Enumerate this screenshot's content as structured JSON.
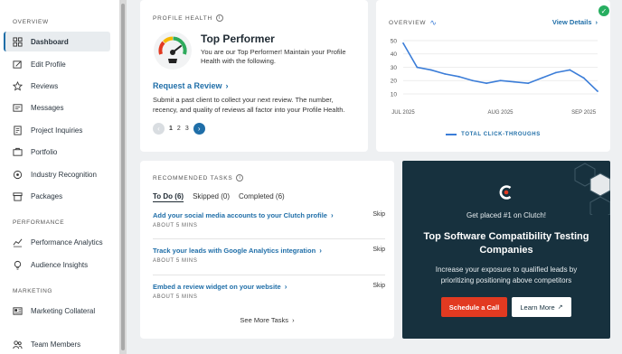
{
  "sidebar": {
    "sections": [
      "OVERVIEW",
      "PERFORMANCE",
      "MARKETING"
    ],
    "items": [
      {
        "label": "Dashboard",
        "icon": "grid-icon"
      },
      {
        "label": "Edit Profile",
        "icon": "edit-profile-icon"
      },
      {
        "label": "Reviews",
        "icon": "star-icon"
      },
      {
        "label": "Messages",
        "icon": "messages-icon"
      },
      {
        "label": "Project Inquiries",
        "icon": "inquiries-icon"
      },
      {
        "label": "Portfolio",
        "icon": "portfolio-icon"
      },
      {
        "label": "Industry Recognition",
        "icon": "recognition-icon"
      },
      {
        "label": "Packages",
        "icon": "packages-icon"
      },
      {
        "label": "Performance Analytics",
        "icon": "analytics-icon"
      },
      {
        "label": "Audience Insights",
        "icon": "bulb-icon"
      },
      {
        "label": "Marketing Collateral",
        "icon": "collateral-icon"
      },
      {
        "label": "Team Members",
        "icon": "team-icon"
      }
    ]
  },
  "profile_health": {
    "label": "PROFILE HEALTH",
    "title": "Top Performer",
    "description": "You are our Top Performer! Maintain your Profile Health with the following.",
    "action_link": "Request a Review",
    "action_text": "Submit a past client to collect your next review. The number, recency, and quality of reviews all factor into your Profile Health.",
    "pages": [
      "1",
      "2",
      "3"
    ]
  },
  "overview": {
    "label": "OVERVIEW",
    "view_details": "View Details",
    "legend": "TOTAL CLICK-THROUGHS"
  },
  "chart_data": {
    "type": "line",
    "x": [
      "JUL 2025",
      "",
      "",
      "",
      "",
      "",
      "",
      "AUG 2025",
      "",
      "",
      "",
      "",
      "",
      "SEP 2025",
      ""
    ],
    "xticks": [
      "JUL 2025",
      "AUG 2025",
      "SEP 2025"
    ],
    "series": [
      {
        "values": [
          48,
          30,
          28,
          25,
          23,
          20,
          18,
          20,
          19,
          18,
          22,
          26,
          28,
          22,
          12
        ]
      }
    ],
    "yticks": [
      10,
      20,
      30,
      40,
      50
    ],
    "ylim": [
      10,
      52
    ],
    "legend": "TOTAL CLICK-THROUGHS",
    "color": "#3b7dd8",
    "grid": true
  },
  "tasks": {
    "label": "RECOMMENDED TASKS",
    "tabs": [
      "To Do (6)",
      "Skipped (0)",
      "Completed (6)"
    ],
    "items": [
      {
        "title": "Add your social media accounts to your Clutch profile",
        "time": "ABOUT 5 MINS",
        "skip": "Skip"
      },
      {
        "title": "Track your leads with Google Analytics integration",
        "time": "ABOUT 5 MINS",
        "skip": "Skip"
      },
      {
        "title": "Embed a review widget on your website",
        "time": "ABOUT 5 MINS",
        "skip": "Skip"
      }
    ],
    "see_more": "See More Tasks"
  },
  "promo": {
    "kicker": "Get placed #1 on Clutch!",
    "title": "Top Software Compatibility Testing Companies",
    "body": "Increase your exposure to qualified leads by prioritizing positioning above competitors",
    "primary_button": "Schedule a Call",
    "secondary_button": "Learn More"
  },
  "colors": {
    "accent": "#1f6ea8",
    "brand_red": "#e23a21",
    "dark": "#17313e",
    "success": "#27ae60"
  }
}
